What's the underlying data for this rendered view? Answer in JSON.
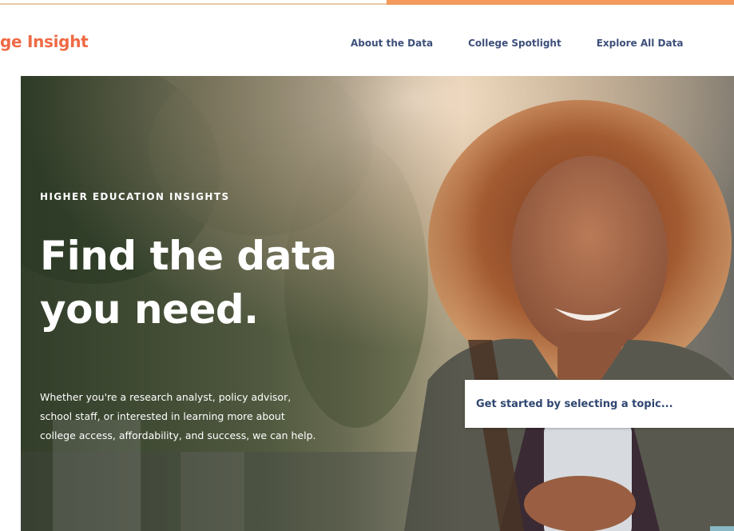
{
  "header": {
    "logo_text": "ge Insight",
    "nav": [
      {
        "label": "About the Data"
      },
      {
        "label": "College Spotlight"
      },
      {
        "label": "Explore All Data"
      }
    ]
  },
  "hero": {
    "eyebrow": "HIGHER EDUCATION INSIGHTS",
    "headline_line1": "Find the data",
    "headline_line2": "you need.",
    "intro_line1": "Whether you're a research analyst, policy advisor,",
    "intro_line2": "school staff, or interested in learning more about",
    "intro_line3": "college access, affordability, and success, we can help.",
    "topic_select_placeholder": "Get started by selecting a topic..."
  },
  "colors": {
    "brand_orange": "#ef6a45",
    "accent_orange": "#f39a5c",
    "nav_text": "#3d4f7a",
    "select_text": "#2f4670"
  }
}
